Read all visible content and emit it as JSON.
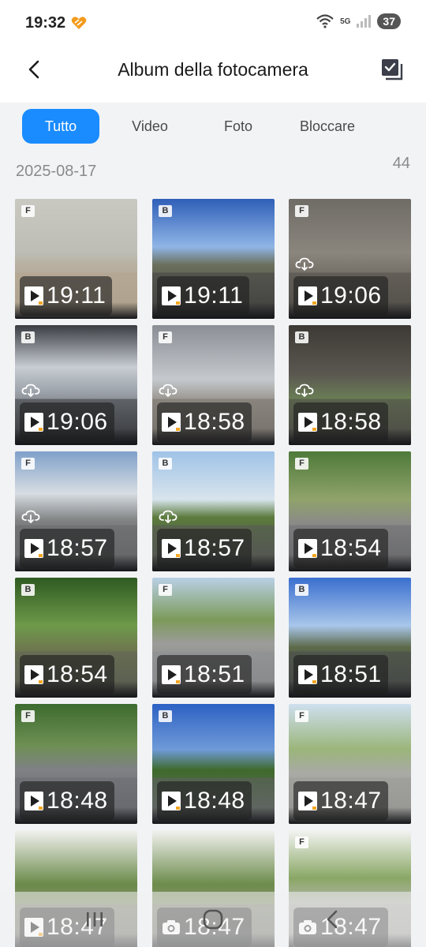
{
  "status_bar": {
    "time": "19:32",
    "network": "5G",
    "battery": "37"
  },
  "header": {
    "title": "Album della fotocamera",
    "back_icon": "chevron-left-icon",
    "select_icon": "multi-select-icon"
  },
  "tabs": [
    {
      "label": "Tutto",
      "active": true
    },
    {
      "label": "Video",
      "active": false
    },
    {
      "label": "Foto",
      "active": false
    },
    {
      "label": "Bloccare",
      "active": false
    }
  ],
  "section": {
    "date": "2025-08-17",
    "count": "44"
  },
  "colors": {
    "accent": "#1a8cff",
    "background": "#f2f3f5",
    "header_background": "#ffffff"
  },
  "media": [
    {
      "camera": "F",
      "time": "19:11",
      "cloud": false,
      "kind": "video"
    },
    {
      "camera": "B",
      "time": "19:11",
      "cloud": false,
      "kind": "video"
    },
    {
      "camera": "F",
      "time": "19:06",
      "cloud": true,
      "kind": "video"
    },
    {
      "camera": "B",
      "time": "19:06",
      "cloud": true,
      "kind": "video"
    },
    {
      "camera": "F",
      "time": "18:58",
      "cloud": true,
      "kind": "video"
    },
    {
      "camera": "B",
      "time": "18:58",
      "cloud": true,
      "kind": "video"
    },
    {
      "camera": "F",
      "time": "18:57",
      "cloud": true,
      "kind": "video"
    },
    {
      "camera": "B",
      "time": "18:57",
      "cloud": true,
      "kind": "video"
    },
    {
      "camera": "F",
      "time": "18:54",
      "cloud": false,
      "kind": "video"
    },
    {
      "camera": "B",
      "time": "18:54",
      "cloud": false,
      "kind": "video"
    },
    {
      "camera": "F",
      "time": "18:51",
      "cloud": false,
      "kind": "video"
    },
    {
      "camera": "B",
      "time": "18:51",
      "cloud": false,
      "kind": "video"
    },
    {
      "camera": "F",
      "time": "18:48",
      "cloud": false,
      "kind": "video"
    },
    {
      "camera": "B",
      "time": "18:48",
      "cloud": false,
      "kind": "video"
    },
    {
      "camera": "F",
      "time": "18:47",
      "cloud": false,
      "kind": "video"
    },
    {
      "camera": "",
      "time": "18:47",
      "cloud": false,
      "kind": "video"
    },
    {
      "camera": "",
      "time": "18:47",
      "cloud": false,
      "kind": "photo"
    },
    {
      "camera": "F",
      "time": "18:47",
      "cloud": false,
      "kind": "photo"
    }
  ],
  "nav_bar": {
    "recents_icon": "recents-icon",
    "home_icon": "home-icon",
    "back_icon": "back-icon"
  }
}
